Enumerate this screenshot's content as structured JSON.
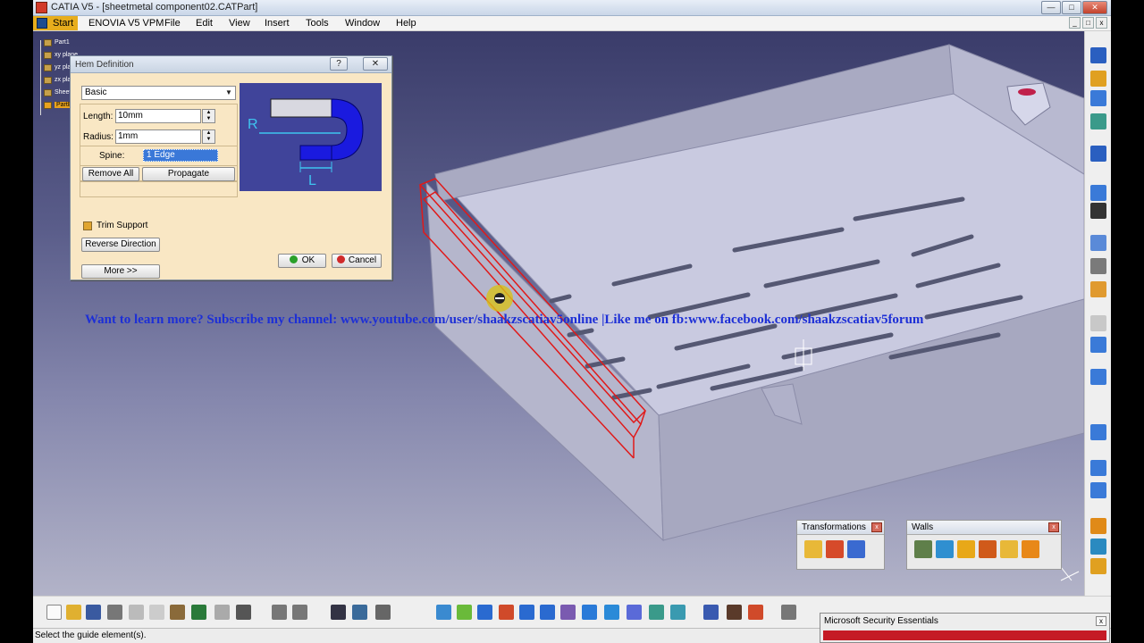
{
  "window": {
    "title": "CATIA V5 - [sheetmetal component02.CATPart]",
    "buttons": {
      "minimize": "—",
      "maximize": "□",
      "close": "✕"
    }
  },
  "menu": {
    "start": "Start",
    "items": [
      "ENOVIA V5 VPM",
      "File",
      "Edit",
      "View",
      "Insert",
      "Tools",
      "Window",
      "Help"
    ]
  },
  "tree": [
    "Part1",
    "xy plane",
    "yz plane",
    "zx plane",
    "Sheet",
    "PartBody"
  ],
  "hem_dialog": {
    "title": "Hem Definition",
    "help": "?",
    "close": "✕",
    "mode": "Basic",
    "length_label": "Length:",
    "length_value": "10mm",
    "radius_label": "Radius:",
    "radius_value": "1mm",
    "spine_label": "Spine:",
    "spine_value": "1 Edge",
    "remove_all": "Remove All",
    "propagate": "Propagate",
    "trim_support": "Trim Support",
    "reverse_direction": "Reverse Direction",
    "more": "More >>",
    "ok": "OK",
    "cancel": "Cancel",
    "preview_r": "R",
    "preview_l": "L"
  },
  "watermark": "Want to learn more? Subscribe my channel: www.youtube.com/user/shaakzscatiav5online |Like me on fb:www.facebook.com/shaakzscatiav5forum",
  "toolbars": {
    "transformations": "Transformations",
    "walls": "Walls"
  },
  "status": "Select the guide element(s).",
  "notification": "Microsoft Security Essentials",
  "colors": {
    "selection": "#e01a1a",
    "dialog_bg": "#f9e7c4",
    "watermark": "#1d2fd6",
    "part": "#cfd0e6"
  }
}
